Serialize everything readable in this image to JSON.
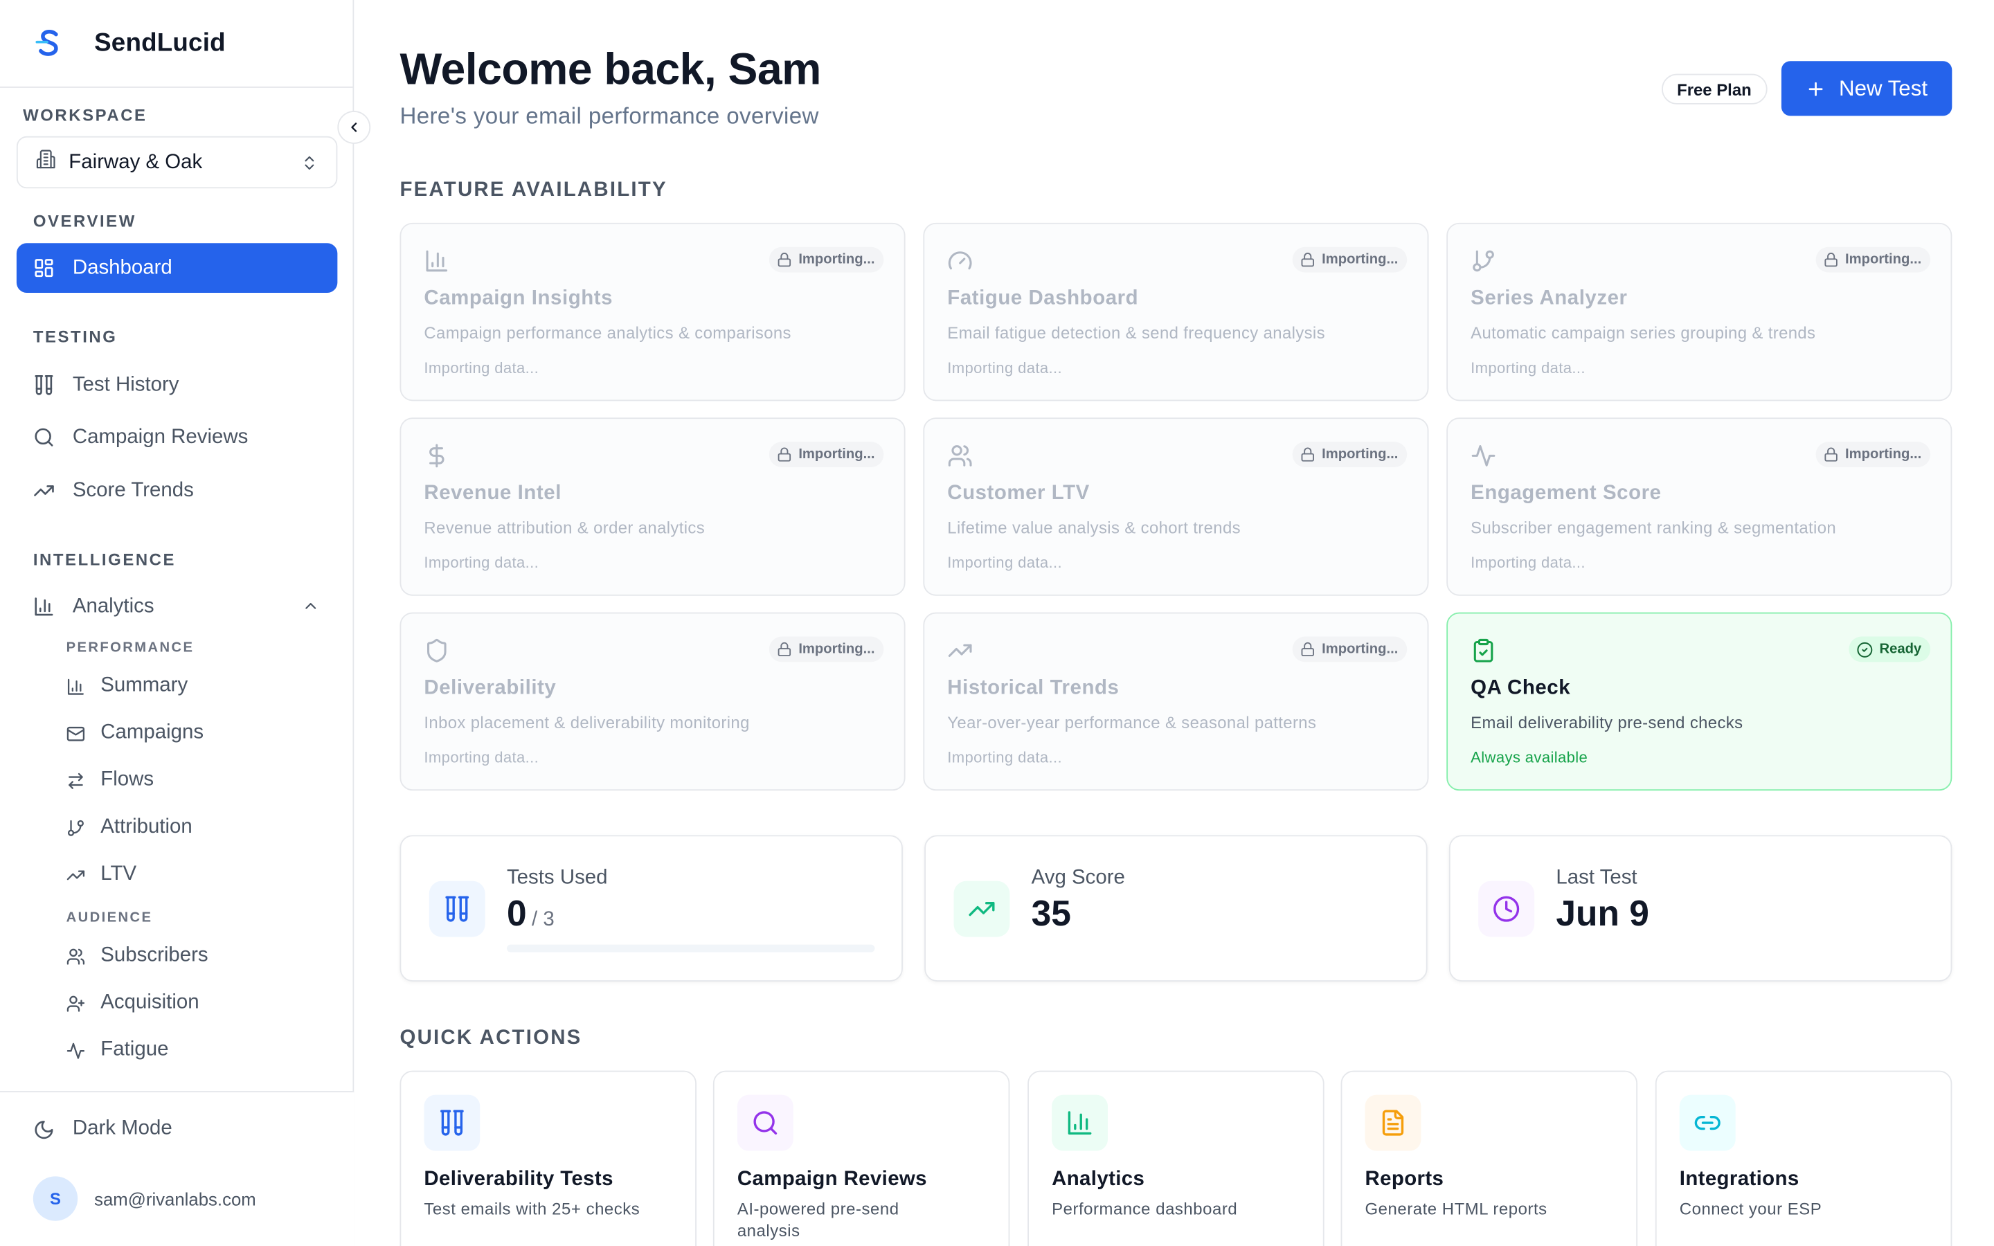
{
  "app": {
    "name": "SendLucid",
    "colors": {
      "accent": "#2563eb",
      "ready_green": "#16a34a",
      "text_primary": "#111827",
      "text_muted": "#64748b"
    }
  },
  "sidebar": {
    "workspace_label": "WORKSPACE",
    "workspace_value": "Fairway & Oak",
    "overview_label": "OVERVIEW",
    "dashboard_label": "Dashboard",
    "testing_label": "TESTING",
    "testing_items": [
      {
        "label": "Test History",
        "icon": "test-tubes-icon"
      },
      {
        "label": "Campaign Reviews",
        "icon": "search-icon"
      },
      {
        "label": "Score Trends",
        "icon": "trending-up-icon"
      }
    ],
    "intelligence_label": "INTELLIGENCE",
    "analytics_label": "Analytics",
    "performance_label": "PERFORMANCE",
    "performance_items": [
      {
        "label": "Summary",
        "icon": "bar-chart-icon"
      },
      {
        "label": "Campaigns",
        "icon": "mail-icon"
      },
      {
        "label": "Flows",
        "icon": "arrows-swap-icon"
      },
      {
        "label": "Attribution",
        "icon": "git-branch-icon"
      },
      {
        "label": "LTV",
        "icon": "trending-up-icon"
      }
    ],
    "audience_label": "AUDIENCE",
    "audience_items": [
      {
        "label": "Subscribers",
        "icon": "users-icon"
      },
      {
        "label": "Acquisition",
        "icon": "user-plus-icon"
      },
      {
        "label": "Fatigue",
        "icon": "activity-icon"
      }
    ],
    "dark_mode_label": "Dark Mode",
    "user_initial": "S",
    "user_email": "sam@rivanlabs.com"
  },
  "header": {
    "title": "Welcome back, Sam",
    "subtitle": "Here's your email performance overview",
    "plan_badge": "Free Plan",
    "new_test_label": "New Test"
  },
  "features": {
    "section_label": "FEATURE AVAILABILITY",
    "cards": [
      {
        "title": "Campaign Insights",
        "description": "Campaign performance analytics & comparisons",
        "badge": "Importing...",
        "status": "Importing data...",
        "icon": "bar-chart-icon",
        "ready": false
      },
      {
        "title": "Fatigue Dashboard",
        "description": "Email fatigue detection & send frequency analysis",
        "badge": "Importing...",
        "status": "Importing data...",
        "icon": "gauge-icon",
        "ready": false
      },
      {
        "title": "Series Analyzer",
        "description": "Automatic campaign series grouping & trends",
        "badge": "Importing...",
        "status": "Importing data...",
        "icon": "git-branch-icon",
        "ready": false
      },
      {
        "title": "Revenue Intel",
        "description": "Revenue attribution & order analytics",
        "badge": "Importing...",
        "status": "Importing data...",
        "icon": "dollar-icon",
        "ready": false
      },
      {
        "title": "Customer LTV",
        "description": "Lifetime value analysis & cohort trends",
        "badge": "Importing...",
        "status": "Importing data...",
        "icon": "users-icon",
        "ready": false
      },
      {
        "title": "Engagement Score",
        "description": "Subscriber engagement ranking & segmentation",
        "badge": "Importing...",
        "status": "Importing data...",
        "icon": "activity-icon",
        "ready": false
      },
      {
        "title": "Deliverability",
        "description": "Inbox placement & deliverability monitoring",
        "badge": "Importing...",
        "status": "Importing data...",
        "icon": "shield-icon",
        "ready": false
      },
      {
        "title": "Historical Trends",
        "description": "Year-over-year performance & seasonal patterns",
        "badge": "Importing...",
        "status": "Importing data...",
        "icon": "trending-up-icon",
        "ready": false
      },
      {
        "title": "QA Check",
        "description": "Email deliverability pre-send checks",
        "badge": "Ready",
        "status": "Always available",
        "icon": "clipboard-check-icon",
        "ready": true
      }
    ]
  },
  "stats": [
    {
      "label": "Tests Used",
      "value": "0",
      "suffix": "/ 3",
      "progress": 0,
      "icon": "test-tubes-icon"
    },
    {
      "label": "Avg Score",
      "value": "35",
      "icon": "trending-up-icon"
    },
    {
      "label": "Last Test",
      "value": "Jun 9",
      "icon": "clock-icon"
    }
  ],
  "quick_actions": {
    "section_label": "QUICK ACTIONS",
    "items": [
      {
        "title": "Deliverability Tests",
        "description": "Test emails with 25+ checks",
        "icon": "test-tubes-icon"
      },
      {
        "title": "Campaign Reviews",
        "description": "AI-powered pre-send analysis",
        "icon": "search-icon"
      },
      {
        "title": "Analytics",
        "description": "Performance dashboard",
        "icon": "bar-chart-icon"
      },
      {
        "title": "Reports",
        "description": "Generate HTML reports",
        "icon": "file-text-icon"
      },
      {
        "title": "Integrations",
        "description": "Connect your ESP",
        "icon": "link-icon"
      }
    ]
  }
}
